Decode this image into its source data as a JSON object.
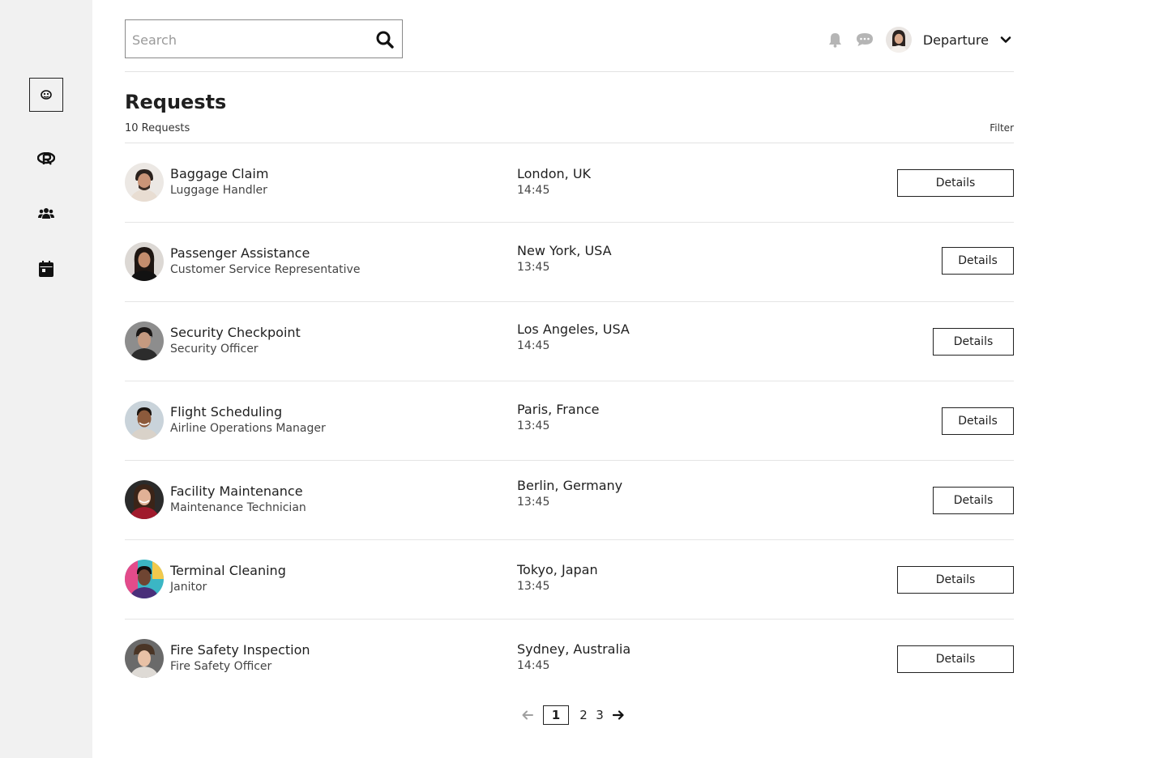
{
  "sidebar": {
    "items": [
      {
        "icon": "dashboard-icon",
        "active": true
      },
      {
        "icon": "registry-icon",
        "active": false
      },
      {
        "icon": "users-icon",
        "active": false
      },
      {
        "icon": "calendar-icon",
        "active": false
      }
    ]
  },
  "header": {
    "search_placeholder": "Search",
    "search_value": "",
    "user_menu_label": "Departure"
  },
  "page": {
    "title": "Requests",
    "count_label": "10 Requests",
    "filter_label": "Filter"
  },
  "requests": [
    {
      "title": "Baggage Claim",
      "role": "Luggage Handler",
      "city": "London, UK",
      "time": "14:45",
      "action": "Details"
    },
    {
      "title": "Passenger Assistance",
      "role": "Customer Service Representative",
      "city": "New York, USA",
      "time": "13:45",
      "action": "Details"
    },
    {
      "title": "Security Checkpoint",
      "role": "Security Officer",
      "city": "Los Angeles, USA",
      "time": "14:45",
      "action": "Details"
    },
    {
      "title": "Flight Scheduling",
      "role": "Airline Operations Manager",
      "city": "Paris, France",
      "time": "13:45",
      "action": "Details"
    },
    {
      "title": "Facility Maintenance",
      "role": "Maintenance Technician",
      "city": "Berlin, Germany",
      "time": "13:45",
      "action": "Details"
    },
    {
      "title": "Terminal Cleaning",
      "role": "Janitor",
      "city": "Tokyo, Japan",
      "time": "13:45",
      "action": "Details"
    },
    {
      "title": "Fire Safety Inspection",
      "role": "Fire Safety Officer",
      "city": "Sydney, Australia",
      "time": "14:45",
      "action": "Details"
    }
  ],
  "pagination": {
    "pages": [
      "1",
      "2",
      "3"
    ],
    "current": "1"
  },
  "colors": {
    "sidebar_bg": "#f1f1f1",
    "text": "#1f1f1f",
    "border": "#222222",
    "divider": "#e2e2e2"
  }
}
